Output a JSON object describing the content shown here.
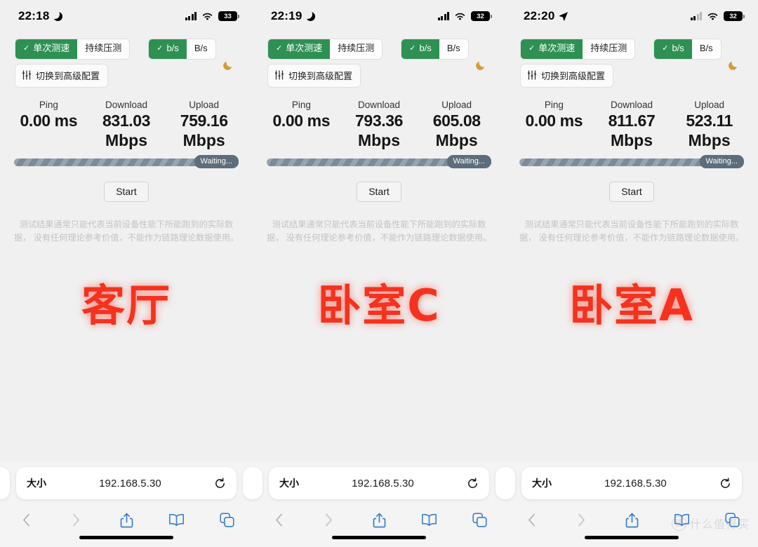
{
  "panels": [
    {
      "status": {
        "time": "22:18",
        "indicator_icon": "moon-icon",
        "battery": "33",
        "signal_icon": "signal-bars-icon",
        "wifi_icon": "wifi-icon"
      },
      "toolbar": {
        "mode_single": "单次测速",
        "mode_stress": "持续压测",
        "unit_bits": "b/s",
        "unit_bytes": "B/s",
        "advanced": "切换到高级配置",
        "check_glyph": "✓",
        "theme_icon": "moon-icon"
      },
      "metrics": {
        "ping_label": "Ping",
        "ping_value": "0.00 ms",
        "download_label": "Download",
        "download_value": "831.03",
        "download_unit": "Mbps",
        "upload_label": "Upload",
        "upload_value": "759.16",
        "upload_unit": "Mbps"
      },
      "progress": {
        "status_text": "Waiting..."
      },
      "start_label": "Start",
      "note": "测试结果通常只能代表当前设备性能下所能跑到的实际数据， 没有任何理论参考价值，不能作为链路理论数据使用。",
      "room_label": "客厅",
      "safari": {
        "size_label": "大小",
        "url": "192.168.5.30",
        "reload_icon": "reload-icon",
        "back_icon": "chevron-left-icon",
        "forward_icon": "chevron-right-icon",
        "share_icon": "share-icon",
        "bookmarks_icon": "book-icon",
        "tabs_icon": "tabs-icon"
      }
    },
    {
      "status": {
        "time": "22:19",
        "indicator_icon": "moon-icon",
        "battery": "32",
        "signal_icon": "signal-bars-icon",
        "wifi_icon": "wifi-icon"
      },
      "toolbar": {
        "mode_single": "单次测速",
        "mode_stress": "持续压测",
        "unit_bits": "b/s",
        "unit_bytes": "B/s",
        "advanced": "切换到高级配置",
        "check_glyph": "✓",
        "theme_icon": "moon-icon"
      },
      "metrics": {
        "ping_label": "Ping",
        "ping_value": "0.00 ms",
        "download_label": "Download",
        "download_value": "793.36",
        "download_unit": "Mbps",
        "upload_label": "Upload",
        "upload_value": "605.08",
        "upload_unit": "Mbps"
      },
      "progress": {
        "status_text": "Waiting..."
      },
      "start_label": "Start",
      "note": "测试结果通常只能代表当前设备性能下所能跑到的实际数据， 没有任何理论参考价值，不能作为链路理论数据使用。",
      "room_label": "卧室C",
      "safari": {
        "size_label": "大小",
        "url": "192.168.5.30",
        "reload_icon": "reload-icon",
        "back_icon": "chevron-left-icon",
        "forward_icon": "chevron-right-icon",
        "share_icon": "share-icon",
        "bookmarks_icon": "book-icon",
        "tabs_icon": "tabs-icon"
      }
    },
    {
      "status": {
        "time": "22:20",
        "indicator_icon": "location-arrow-icon",
        "battery": "32",
        "signal_icon": "signal-bars-icon",
        "wifi_icon": "wifi-icon"
      },
      "toolbar": {
        "mode_single": "单次测速",
        "mode_stress": "持续压测",
        "unit_bits": "b/s",
        "unit_bytes": "B/s",
        "advanced": "切换到高级配置",
        "check_glyph": "✓",
        "theme_icon": "moon-icon"
      },
      "metrics": {
        "ping_label": "Ping",
        "ping_value": "0.00 ms",
        "download_label": "Download",
        "download_value": "811.67",
        "download_unit": "Mbps",
        "upload_label": "Upload",
        "upload_value": "523.11",
        "upload_unit": "Mbps"
      },
      "progress": {
        "status_text": "Waiting..."
      },
      "start_label": "Start",
      "note": "测试结果通常只能代表当前设备性能下所能跑到的实际数据， 没有任何理论参考价值，不能作为链路理论数据使用。",
      "room_label": "卧室A",
      "safari": {
        "size_label": "大小",
        "url": "192.168.5.30",
        "reload_icon": "reload-icon",
        "back_icon": "chevron-left-icon",
        "forward_icon": "chevron-right-icon",
        "share_icon": "share-icon",
        "bookmarks_icon": "book-icon",
        "tabs_icon": "tabs-icon"
      }
    }
  ],
  "watermark": {
    "mark": "值",
    "text": "什么值得买"
  },
  "colors": {
    "accent_green": "#2e9153",
    "room_red": "#f5321e",
    "progress_slate": "#7b8b99",
    "safari_blue": "#3b7fc4",
    "background": "#f0f0f0"
  }
}
